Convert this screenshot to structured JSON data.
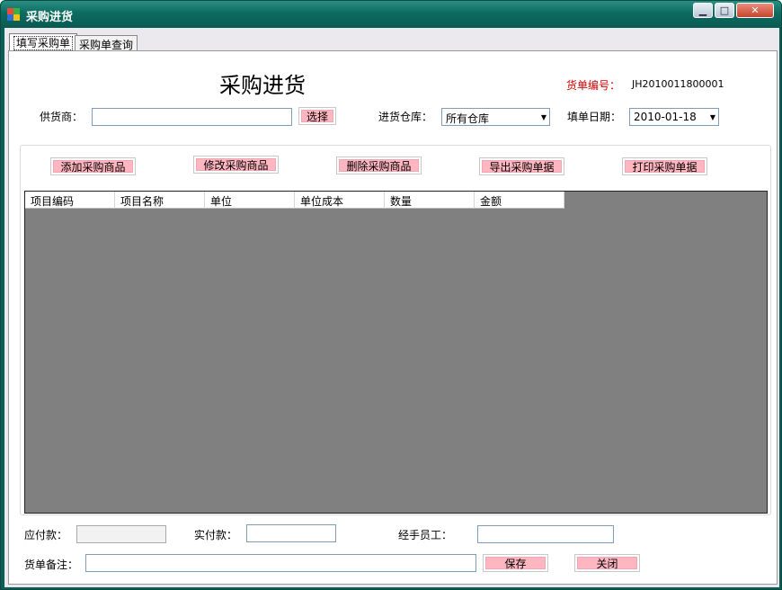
{
  "window": {
    "title": "采购进货",
    "controls": {
      "minimize": "▁",
      "maximize": "□",
      "close": "✕"
    }
  },
  "tabs": [
    {
      "label": "填写采购单",
      "active": true
    },
    {
      "label": "采购单查询",
      "active": false
    }
  ],
  "form": {
    "heading": "采购进货",
    "order_no_label": "货单编号：",
    "order_no_value": "JH2010011800001",
    "supplier_label": "供货商：",
    "supplier_value": "",
    "select_button": "选择",
    "warehouse_label": "进货仓库：",
    "warehouse_value": "所有仓库",
    "date_label": "填单日期：",
    "date_value": "2010-01-18"
  },
  "actions": {
    "add": "添加采购商品",
    "edit": "修改采购商品",
    "delete": "删除采购商品",
    "export": "导出采购单据",
    "print": "打印采购单据"
  },
  "table": {
    "columns": [
      "项目编码",
      "项目名称",
      "单位",
      "单位成本",
      "数量",
      "金额"
    ],
    "rows": []
  },
  "footer": {
    "payable_label": "应付款：",
    "payable_value": "",
    "paid_label": "实付款：",
    "paid_value": "",
    "handler_label": "经手员工：",
    "handler_value": "",
    "remark_label": "货单备注：",
    "remark_value": "",
    "save_button": "保存",
    "close_button": "关闭"
  },
  "colors": {
    "title_bar": "#0c6b60",
    "button_fill": "#ffb6c1",
    "order_label": "#d40000",
    "grid_bg": "#808080"
  }
}
